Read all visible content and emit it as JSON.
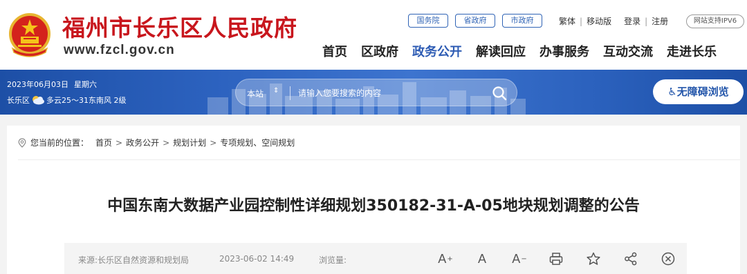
{
  "header": {
    "site_name": "福州市长乐区人民政府",
    "site_url": "www.fzcl.gov.cn",
    "gov_links": [
      "国务院",
      "省政府",
      "市政府"
    ],
    "util_links": [
      "繁体",
      "移动版",
      "登录",
      "注册"
    ],
    "ipv6_badge": "网站支持IPV6",
    "nav": [
      "首页",
      "区政府",
      "政务公开",
      "解读回应",
      "办事服务",
      "互动交流",
      "走进长乐"
    ],
    "active_nav": "政务公开"
  },
  "banner": {
    "date": "2023年06月03日",
    "weekday": "星期六",
    "region": "长乐区",
    "weather": "多云25～31东南风 2级",
    "search_scope": "本站",
    "search_placeholder": "请输入您要搜索的内容",
    "accessibility_label": "♿无障碍浏览"
  },
  "breadcrumb": {
    "prefix": "您当前的位置：",
    "items": [
      "首页",
      "政务公开",
      "规划计划",
      "专项规划、空间规划"
    ]
  },
  "article": {
    "title": "中国东南大数据产业园控制性详细规划350182-31-A-05地块规划调整的公告",
    "source": "来源:长乐区自然资源和规划局",
    "date": "2023-06-02 14:49",
    "views_label": "浏览量:"
  },
  "tools": {
    "font_increase": "A",
    "font_increase_mark": "+",
    "font_default": "A",
    "font_decrease": "A",
    "font_decrease_mark": "−"
  },
  "colors": {
    "brand_red": "#c8161d",
    "nav_active_blue": "#2e5cb4",
    "banner_blue": "#2d63c0"
  }
}
